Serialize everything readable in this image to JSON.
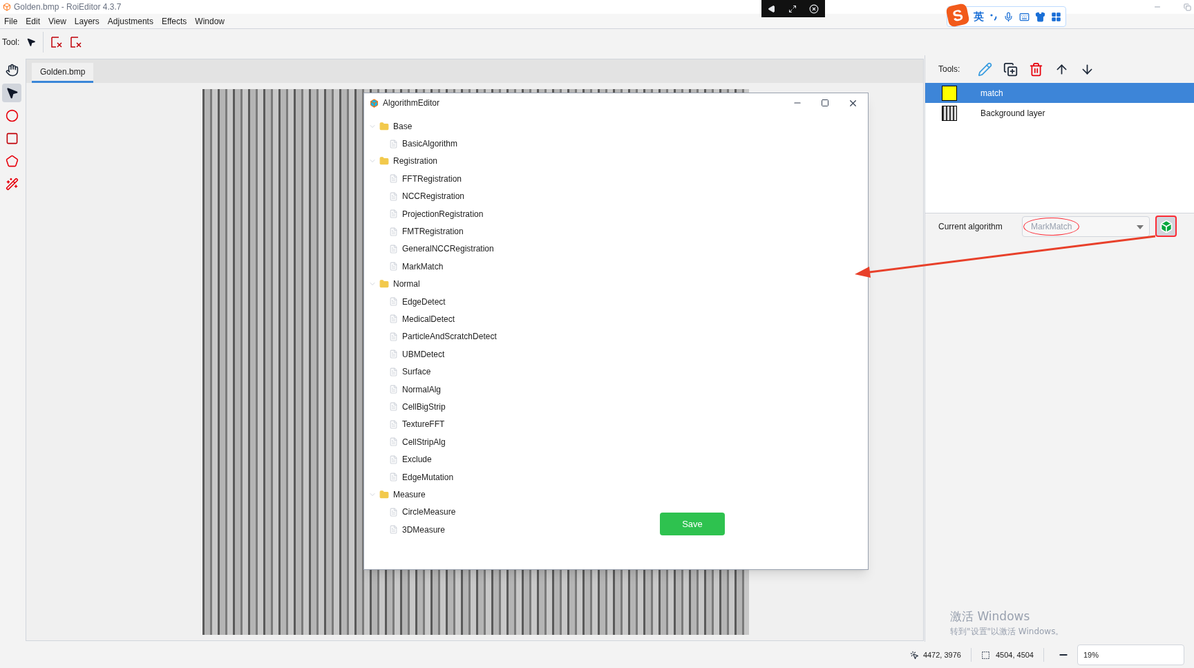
{
  "window": {
    "title": "Golden.bmp - RoiEditor 4.3.7"
  },
  "menu": [
    "File",
    "Edit",
    "View",
    "Layers",
    "Adjustments",
    "Effects",
    "Window"
  ],
  "toolbar": {
    "label": "Tool:"
  },
  "tools": [
    {
      "kind": "hand",
      "selected": false
    },
    {
      "kind": "pointer",
      "selected": true
    },
    {
      "kind": "circle",
      "selected": false
    },
    {
      "kind": "rectangle",
      "selected": false
    },
    {
      "kind": "polygon",
      "selected": false
    },
    {
      "kind": "wand",
      "selected": false
    }
  ],
  "document_tabs": [
    {
      "label": "Golden.bmp",
      "selected": true
    }
  ],
  "algorithm_editor": {
    "title": "AlgorithmEditor",
    "tree": [
      {
        "label": "Base",
        "expanded": true,
        "children": [
          {
            "label": "BasicAlgorithm"
          }
        ]
      },
      {
        "label": "Registration",
        "expanded": true,
        "children": [
          {
            "label": "FFTRegistration"
          },
          {
            "label": "NCCRegistration"
          },
          {
            "label": "ProjectionRegistration"
          },
          {
            "label": "FMTRegistration"
          },
          {
            "label": "GeneralNCCRegistration"
          },
          {
            "label": "MarkMatch"
          }
        ]
      },
      {
        "label": "Normal",
        "expanded": true,
        "children": [
          {
            "label": "EdgeDetect"
          },
          {
            "label": "MedicalDetect"
          },
          {
            "label": "ParticleAndScratchDetect"
          },
          {
            "label": "UBMDetect"
          },
          {
            "label": "Surface"
          },
          {
            "label": "NormalAlg"
          },
          {
            "label": "CellBigStrip"
          },
          {
            "label": "TextureFFT"
          },
          {
            "label": "CellStripAlg"
          },
          {
            "label": "Exclude"
          },
          {
            "label": "EdgeMutation"
          }
        ]
      },
      {
        "label": "Measure",
        "expanded": true,
        "children": [
          {
            "label": "CircleMeasure"
          },
          {
            "label": "3DMeasure"
          }
        ]
      }
    ],
    "save_button": "Save"
  },
  "layers_panel": {
    "tools_label": "Tools:",
    "layers": [
      {
        "name": "match",
        "selected": true,
        "kind": "swatch",
        "color": "#ffff00"
      },
      {
        "name": "Background layer",
        "selected": false,
        "kind": "thumbnail"
      }
    ],
    "current_algorithm": {
      "label": "Current algorithm",
      "value": "MarkMatch"
    }
  },
  "status_bar": {
    "cursor": "4472, 3976",
    "size": "4504, 4504",
    "zoom": "19%"
  },
  "ime_toolbar": {
    "logo": "S",
    "language": "英"
  },
  "activation_notice": {
    "title": "激活 Windows",
    "text": "转到\"设置\"以激活 Windows。"
  }
}
